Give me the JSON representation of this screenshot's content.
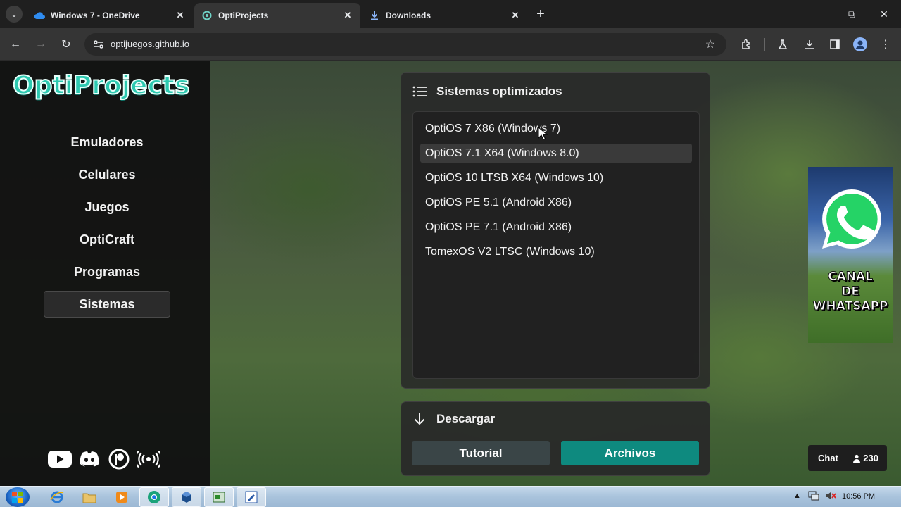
{
  "browser": {
    "tabs": [
      {
        "title": "Windows 7 - OneDrive",
        "active": false
      },
      {
        "title": "OptiProjects",
        "active": true
      },
      {
        "title": "Downloads",
        "active": false
      }
    ],
    "url": "optijuegos.github.io"
  },
  "site": {
    "logo_text": "OptiProjects",
    "nav": [
      {
        "label": "Emuladores",
        "active": false
      },
      {
        "label": "Celulares",
        "active": false
      },
      {
        "label": "Juegos",
        "active": false
      },
      {
        "label": "OptiCraft",
        "active": false
      },
      {
        "label": "Programas",
        "active": false
      },
      {
        "label": "Sistemas",
        "active": true
      }
    ],
    "social_icons": [
      "youtube-icon",
      "discord-icon",
      "patreon-icon",
      "broadcast-icon"
    ]
  },
  "systems_panel": {
    "title": "Sistemas optimizados",
    "items": [
      "OptiOS 7 X86 (Windows 7)",
      "OptiOS 7.1 X64 (Windows 8.0)",
      "OptiOS 10 LTSB X64 (Windows 10)",
      "OptiOS PE 5.1 (Android X86)",
      "OptiOS PE 7.1 (Android X86)",
      "TomexOS V2 LTSC (Windows 10)"
    ],
    "hovered_index": 1
  },
  "download_panel": {
    "title": "Descargar",
    "tutorial_label": "Tutorial",
    "files_label": "Archivos"
  },
  "whatsapp_banner": {
    "line1": "CANAL",
    "line2": "DE",
    "line3": "WHATSAPP"
  },
  "chat": {
    "label": "Chat",
    "count": "230"
  },
  "taskbar": {
    "time": "10:56 PM"
  },
  "colors": {
    "accent": "#0e8a7f",
    "logo": "#2dc9b0"
  }
}
